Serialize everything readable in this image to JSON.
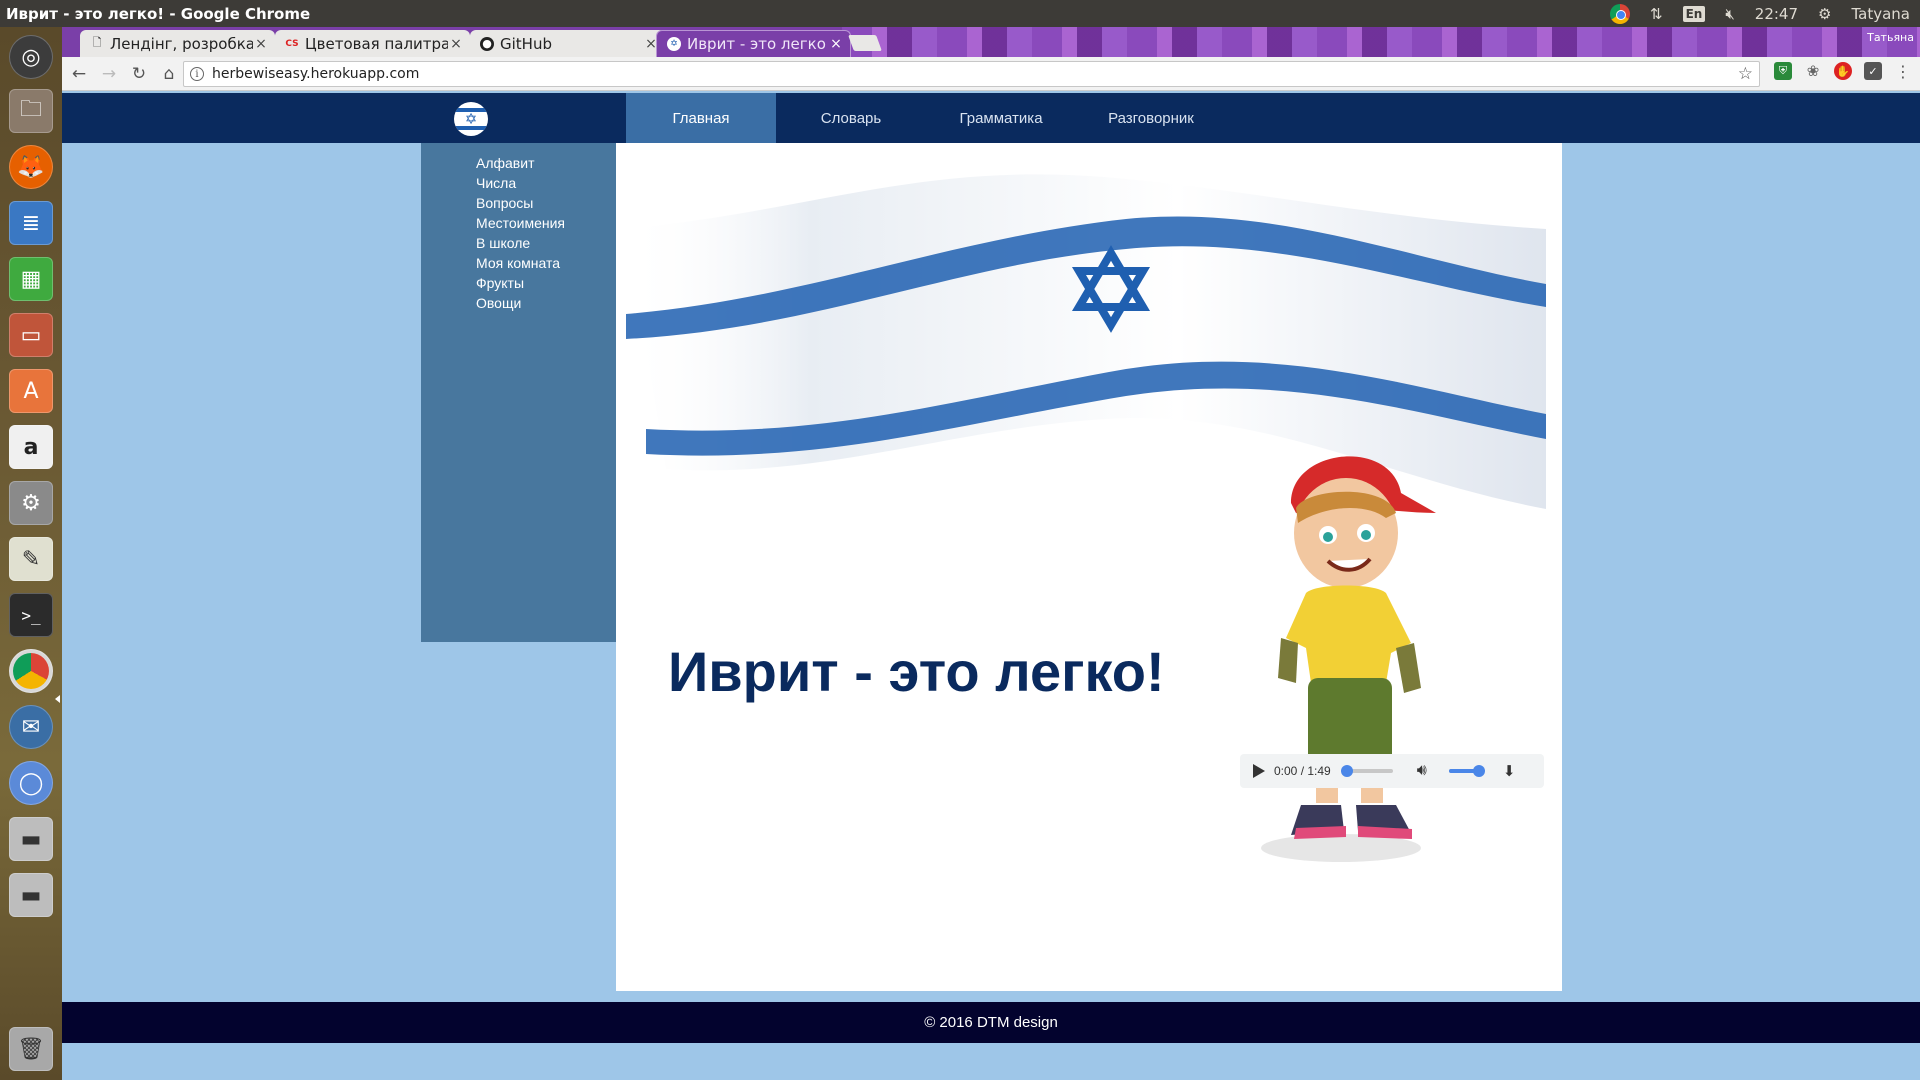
{
  "os": {
    "window_title": "Иврит - это легко! - Google Chrome",
    "keyboard_layout": "En",
    "clock": "22:47",
    "user": "Tatyana"
  },
  "browser": {
    "profile_name": "Татьяна",
    "tabs": [
      {
        "title": "Лендінг, розробка",
        "favicon": "document-icon",
        "active": false
      },
      {
        "title": "Цветовая палитра",
        "favicon": "colorscheme-icon",
        "active": false
      },
      {
        "title": "GitHub",
        "favicon": "github-icon",
        "active": false
      },
      {
        "title": "Иврит - это легко!",
        "favicon": "site-icon",
        "active": true
      }
    ],
    "url": "herbewiseasy.herokuapp.com"
  },
  "site": {
    "menu": [
      {
        "label": "Главная",
        "active": true
      },
      {
        "label": "Словарь",
        "active": false
      },
      {
        "label": "Грамматика",
        "active": false
      },
      {
        "label": "Разговорник",
        "active": false
      }
    ],
    "sidebar": [
      "Алфавит",
      "Числа",
      "Вопросы",
      "Местоимения",
      "В школе",
      "Моя комната",
      "Фрукты",
      "Овощи"
    ],
    "hero_title": "Иврит - это легко!",
    "audio": {
      "current": "0:00",
      "duration": "1:49",
      "time_display": "0:00 / 1:49",
      "progress": 0,
      "volume": 1
    },
    "footer": "© 2016 DTM design"
  },
  "colors": {
    "nav_bg": "#0a2a5e",
    "nav_active": "#3a6ea5",
    "sidebar_bg": "#48779e",
    "page_bg": "#9ec6e8",
    "title_color": "#0a2a5e",
    "footer_bg": "#03032e",
    "flag_blue": "#1f5fb0"
  }
}
